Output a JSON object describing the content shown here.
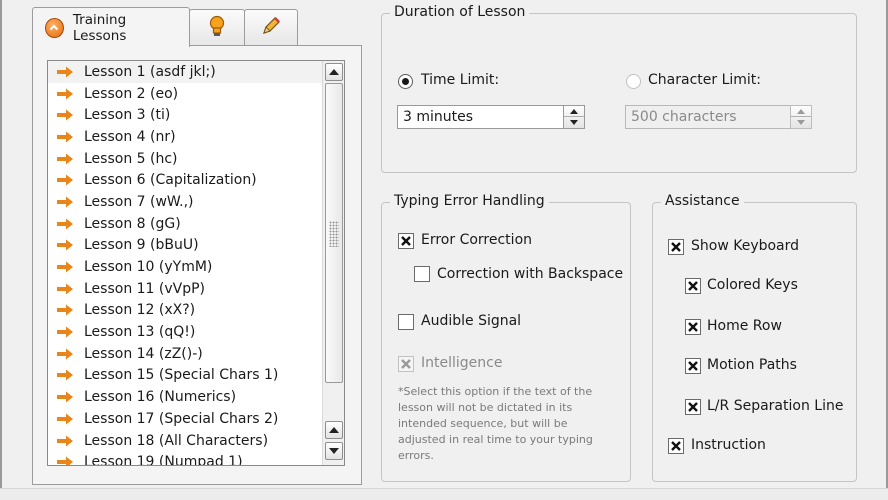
{
  "tabs": {
    "training_label": "Training Lessons",
    "hint_icon": "lightbulb-icon",
    "edit_icon": "pencil-icon"
  },
  "lessons": [
    "Lesson 1 (asdf jkl;)",
    "Lesson 2 (eo)",
    "Lesson 3 (ti)",
    "Lesson 4 (nr)",
    "Lesson 5 (hc)",
    "Lesson 6 (Capitalization)",
    "Lesson 7 (wW.,)",
    "Lesson 8 (gG)",
    "Lesson 9 (bBuU)",
    "Lesson 10 (yYmM)",
    "Lesson 11 (vVpP)",
    "Lesson 12 (xX?)",
    "Lesson 13 (qQ!)",
    "Lesson 14 (zZ()-)",
    "Lesson 15 (Special Chars 1)",
    "Lesson 16 (Numerics)",
    "Lesson 17 (Special Chars 2)",
    "Lesson 18 (All Characters)",
    "Lesson 19 (Numpad 1)"
  ],
  "duration": {
    "title": "Duration of Lesson",
    "time_limit_label": "Time Limit:",
    "time_limit_value": "3 minutes",
    "char_limit_label": "Character Limit:",
    "char_limit_value": "500 characters"
  },
  "errors": {
    "title": "Typing Error Handling",
    "error_correction": "Error Correction",
    "correction_backspace": "Correction with Backspace",
    "audible_signal": "Audible Signal",
    "intelligence": "Intelligence",
    "note_lines": [
      "*Select this option if the text of the",
      "lesson will not be dictated in its",
      "intended sequence, but will be",
      "adjusted in real time to your typing",
      "errors."
    ]
  },
  "assistance": {
    "title": "Assistance",
    "show_keyboard": "Show Keyboard",
    "colored_keys": "Colored Keys",
    "home_row": "Home Row",
    "motion_paths": "Motion Paths",
    "lr_separation": "L/R Separation Line",
    "instruction": "Instruction"
  },
  "colors": {
    "accent_orange": "#e8861a",
    "window_bg": "#f0f0f0",
    "border": "#9c9c9c"
  }
}
